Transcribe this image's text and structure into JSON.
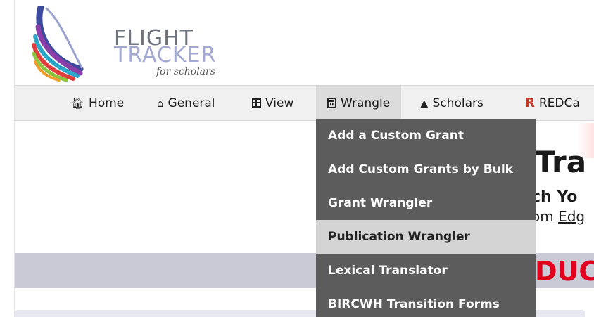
{
  "logo": {
    "line1": "FLIGHT",
    "line2": "TRACKER",
    "line3": "for scholars"
  },
  "nav": {
    "items": [
      {
        "label": "Home",
        "icon": "home-icon"
      },
      {
        "label": "General",
        "icon": "house-outline-icon"
      },
      {
        "label": "View",
        "icon": "table-icon"
      },
      {
        "label": "Wrangle",
        "icon": "calculator-icon"
      },
      {
        "label": "Scholars",
        "icon": "scholars-icon"
      },
      {
        "label": "REDCa",
        "icon": "redcap-icon"
      }
    ],
    "active": "Wrangle"
  },
  "dropdown": {
    "items": [
      "Add a Custom Grant",
      "Add Custom Grants by Bulk",
      "Grant Wrangler",
      "Publication Wrangler",
      "Lexical Translator",
      "BIRCWH Transition Forms"
    ],
    "highlighted": "Publication Wrangler"
  },
  "page": {
    "heading_fragment": "Tra",
    "subheading_fragment": "ch Yo",
    "from_prefix": "om ",
    "from_link": "Edg",
    "intro_fragment": "DUC"
  },
  "colors": {
    "dropdown_bg": "#5c5c5c",
    "highlight_bg": "#d4d4d4",
    "intro_red": "#e1001e",
    "band_gray": "#c9cad6"
  }
}
